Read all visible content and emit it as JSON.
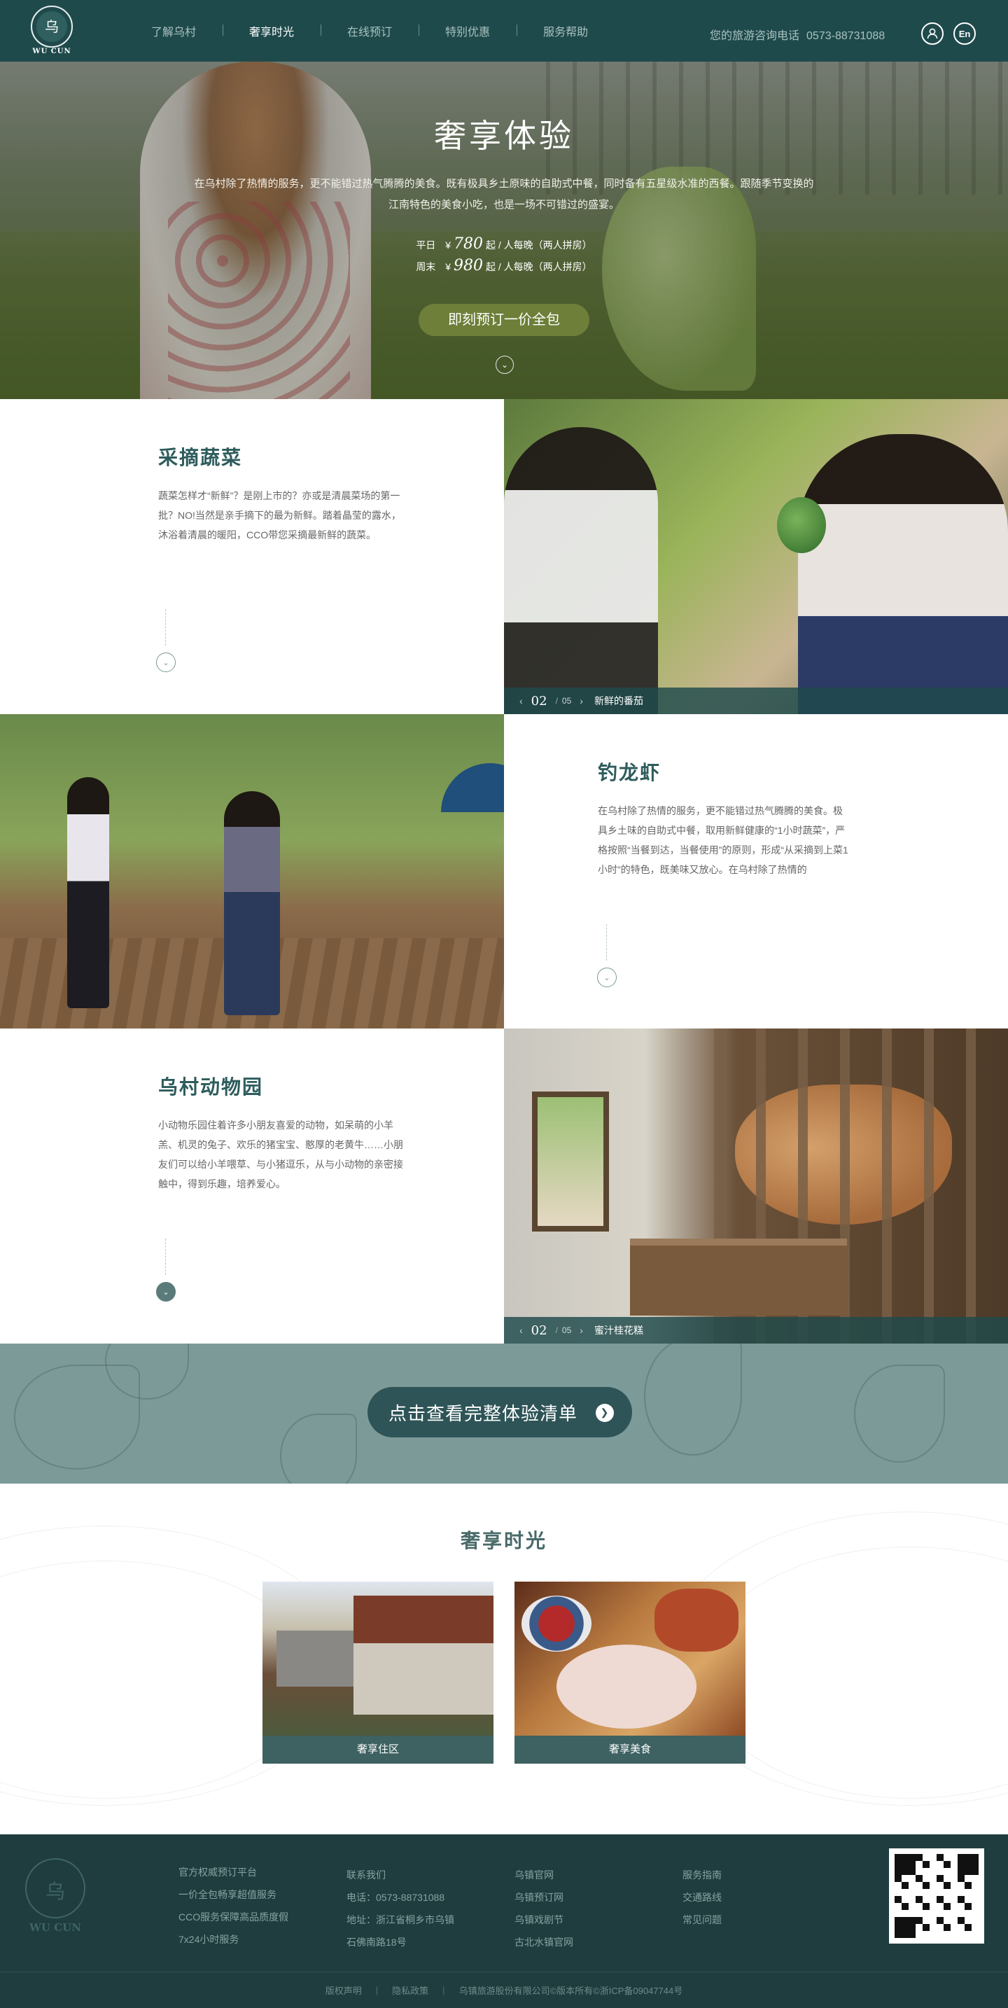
{
  "nav": {
    "logo_glyph": "乌",
    "logo_text": "WU CUN",
    "items": [
      "了解乌村",
      "奢享时光",
      "在线预订",
      "特别优惠",
      "服务帮助"
    ],
    "active_index": 1,
    "phone_label": "您的旅游咨询电话",
    "phone": "0573-88731088",
    "user_icon": "user-icon",
    "lang_label": "En"
  },
  "hero": {
    "title": "奢享体验",
    "desc_line1": "在乌村除了热情的服务，更不能错过热气腾腾的美食。既有极具乡土原味的自助式中餐，同时备有五星级水准的西餐。跟随季节变换的",
    "desc_line2": "江南特色的美食小吃，也是一场不可错过的盛宴。",
    "weekday_label": "平日",
    "weekday_currency": "¥",
    "weekday_price": "780",
    "weekday_unit": "起 / 人每晚（两人拼房）",
    "weekend_label": "周末",
    "weekend_currency": "¥",
    "weekend_price": "980",
    "weekend_unit": "起 / 人每晚（两人拼房）",
    "button": "即刻预订一价全包",
    "down_icon": "chevron-down-icon"
  },
  "features": [
    {
      "title": "采摘蔬菜",
      "desc": "蔬菜怎样才“新鲜”？是刚上市的？亦或是清晨菜场的第一批？NO!当然是亲手摘下的最为新鲜。踏着晶莹的露水，沐浴着清晨的暖阳，CCO带您采摘最新鲜的蔬菜。",
      "current": "02",
      "total": "05",
      "caption": "新鲜的番茄"
    },
    {
      "title": "钓龙虾",
      "desc": "在乌村除了热情的服务，更不能错过热气腾腾的美食。极具乡土味的自助式中餐，取用新鲜健康的“1小时蔬菜”，严格按照“当餐到达，当餐使用”的原则，形成“从采摘到上菜1小时”的特色，既美味又放心。在乌村除了热情的"
    },
    {
      "title": "乌村动物园",
      "desc": "小动物乐园住着许多小朋友喜爱的动物，如呆萌的小羊羔、机灵的兔子、欢乐的猪宝宝、憨厚的老黄牛……小朋友们可以给小羊喂草、与小猪逗乐，从与小动物的亲密接触中，得到乐趣，培养爱心。",
      "current": "02",
      "total": "05",
      "caption": "蜜汁桂花糕"
    }
  ],
  "cta": {
    "button": "点击查看完整体验清单",
    "arrow_icon": "arrow-right-icon"
  },
  "luxury": {
    "title": "奢享时光",
    "cards": [
      {
        "caption": "奢享住区"
      },
      {
        "caption": "奢享美食"
      }
    ]
  },
  "footer": {
    "logo_glyph": "乌",
    "logo_text": "WU CUN",
    "col1": [
      "官方权威预订平台",
      "一价全包畅享超值服务",
      "CCO服务保障高品质度假",
      "7x24小时服务"
    ],
    "col2": [
      "联系我们",
      "电话：0573-88731088",
      "地址：浙江省桐乡市乌镇",
      "石佛南路18号"
    ],
    "col3": [
      "乌镇官网",
      "乌镇预订网",
      "乌镇戏剧节",
      "古北水镇官网"
    ],
    "col4": [
      "服务指南",
      "交通路线",
      "常见问题"
    ],
    "bottom_links": [
      "版权声明",
      "隐私政策"
    ],
    "copyright": "乌镇旅游股份有限公司©版本所有©浙ICP备09047744号"
  }
}
